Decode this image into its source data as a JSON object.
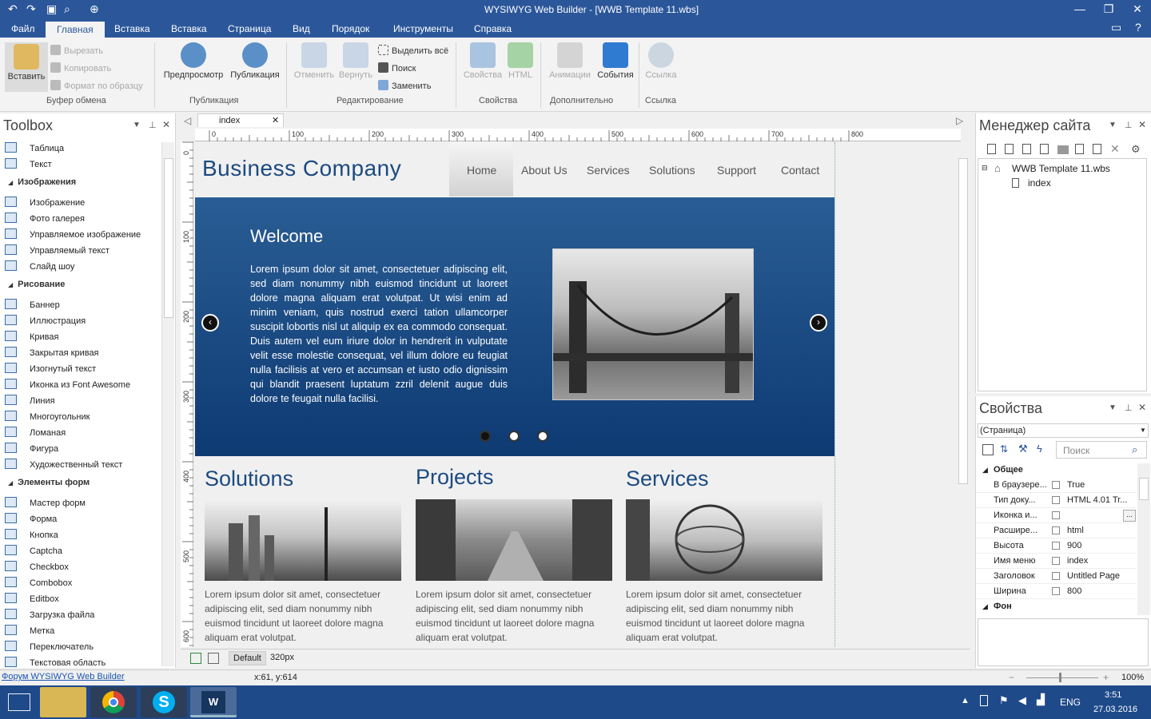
{
  "app": {
    "title": "WYSIWYG Web Builder - [WWB Template 11.wbs]"
  },
  "menu": {
    "items": [
      "Файл",
      "Главная",
      "Вставка",
      "Вставка",
      "Страница",
      "Вид",
      "Порядок",
      "Инструменты",
      "Справка"
    ],
    "active": "Главная"
  },
  "ribbon": {
    "paste": "Вставить",
    "cut": "Вырезать",
    "copy": "Копировать",
    "format": "Формат по образцу",
    "group_clipboard": "Буфер обмена",
    "preview": "Предпросмотр",
    "publish": "Публикация",
    "group_publish": "Публикация",
    "undo": "Отменить",
    "redo": "Вернуть",
    "select_all": "Выделить всё",
    "search": "Поиск",
    "replace": "Заменить",
    "group_edit": "Редактирование",
    "properties": "Свойства",
    "html": "HTML",
    "group_props": "Свойства",
    "animations": "Анимации",
    "events": "События",
    "group_extra": "Дополнительно",
    "link": "Ссылка",
    "group_link": "Ссылка"
  },
  "toolbox": {
    "title": "Toolbox",
    "items": [
      {
        "kind": "item",
        "label": "Таблица",
        "icon": "table-icon"
      },
      {
        "kind": "item",
        "label": "Текст",
        "icon": "text-icon"
      },
      {
        "kind": "cat",
        "label": "Изображения"
      },
      {
        "kind": "item",
        "label": "Изображение",
        "icon": "image-icon"
      },
      {
        "kind": "item",
        "label": "Фото галерея",
        "icon": "gallery-icon"
      },
      {
        "kind": "item",
        "label": "Управляемое изображение",
        "icon": "managed-image-icon"
      },
      {
        "kind": "item",
        "label": "Управляемый текст",
        "icon": "managed-text-icon"
      },
      {
        "kind": "item",
        "label": "Слайд шоу",
        "icon": "slideshow-icon"
      },
      {
        "kind": "cat",
        "label": "Рисование"
      },
      {
        "kind": "item",
        "label": "Баннер",
        "icon": "banner-icon"
      },
      {
        "kind": "item",
        "label": "Иллюстрация",
        "icon": "illustration-icon"
      },
      {
        "kind": "item",
        "label": "Кривая",
        "icon": "curve-icon"
      },
      {
        "kind": "item",
        "label": "Закрытая кривая",
        "icon": "closed-curve-icon"
      },
      {
        "kind": "item",
        "label": "Изогнутый текст",
        "icon": "curved-text-icon"
      },
      {
        "kind": "item",
        "label": "Иконка из Font Awesome",
        "icon": "font-awesome-icon"
      },
      {
        "kind": "item",
        "label": "Линия",
        "icon": "line-icon"
      },
      {
        "kind": "item",
        "label": "Многоугольник",
        "icon": "polygon-icon"
      },
      {
        "kind": "item",
        "label": "Ломаная",
        "icon": "polyline-icon"
      },
      {
        "kind": "item",
        "label": "Фигура",
        "icon": "shape-icon"
      },
      {
        "kind": "item",
        "label": "Художественный текст",
        "icon": "art-text-icon"
      },
      {
        "kind": "cat",
        "label": "Элементы форм"
      },
      {
        "kind": "item",
        "label": "Мастер форм",
        "icon": "form-wizard-icon"
      },
      {
        "kind": "item",
        "label": "Форма",
        "icon": "form-icon"
      },
      {
        "kind": "item",
        "label": "Кнопка",
        "icon": "button-icon"
      },
      {
        "kind": "item",
        "label": "Captcha",
        "icon": "captcha-icon"
      },
      {
        "kind": "item",
        "label": "Checkbox",
        "icon": "checkbox-icon"
      },
      {
        "kind": "item",
        "label": "Combobox",
        "icon": "combobox-icon"
      },
      {
        "kind": "item",
        "label": "Editbox",
        "icon": "editbox-icon"
      },
      {
        "kind": "item",
        "label": "Загрузка файла",
        "icon": "file-upload-icon"
      },
      {
        "kind": "item",
        "label": "Метка",
        "icon": "label-icon"
      },
      {
        "kind": "item",
        "label": "Переключатель",
        "icon": "radio-icon"
      },
      {
        "kind": "item",
        "label": "Текстовая область",
        "icon": "textarea-icon"
      }
    ]
  },
  "doc": {
    "tab": "index",
    "ruler": [
      "0",
      "100",
      "200",
      "300",
      "400",
      "500",
      "600",
      "700",
      "800"
    ],
    "vruler": [
      "0",
      "100",
      "200",
      "300",
      "400",
      "500",
      "600"
    ]
  },
  "site": {
    "brand": "Business Company",
    "nav": [
      "Home",
      "About Us",
      "Services",
      "Solutions",
      "Support",
      "Contact"
    ],
    "hero_title": "Welcome",
    "hero_text": "Lorem ipsum dolor sit amet, consectetuer adipiscing elit, sed diam nonummy nibh euismod tincidunt ut laoreet dolore magna aliquam erat volutpat. Ut wisi enim ad minim veniam, quis nostrud exerci tation ullamcorper suscipit lobortis nisl ut aliquip ex ea commodo consequat. Duis autem vel eum iriure dolor in hendrerit in vulputate velit esse molestie consequat, vel illum dolore eu feugiat nulla facilisis at vero et accumsan et iusto odio dignissim qui blandit praesent luptatum zzril delenit augue duis dolore te feugait nulla facilisi.",
    "columns": [
      {
        "title": "Solutions",
        "text": "Lorem ipsum dolor sit amet, consectetuer adipiscing elit, sed diam nonummy nibh euismod tincidunt ut laoreet dolore magna aliquam erat volutpat."
      },
      {
        "title": "Projects",
        "text": "Lorem ipsum dolor sit amet, consectetuer adipiscing elit, sed diam nonummy nibh euismod tincidunt ut laoreet dolore magna aliquam erat volutpat."
      },
      {
        "title": "Services",
        "text": "Lorem ipsum dolor sit amet, consectetuer adipiscing elit, sed diam nonummy nibh euismod tincidunt ut laoreet dolore magna aliquam erat volutpat."
      }
    ]
  },
  "breakpoints": {
    "default": "Default",
    "size": "320px"
  },
  "sitemgr": {
    "title": "Менеджер сайта",
    "root": "WWB Template 11.wbs",
    "page": "index"
  },
  "props": {
    "title": "Свойства",
    "selector": "(Страница)",
    "search_placeholder": "Поиск",
    "cat_general": "Общее",
    "cat_bg": "Фон",
    "rows": [
      {
        "k": "В браузере...",
        "v": "True"
      },
      {
        "k": "Тип доку...",
        "v": "HTML 4.01 Tr..."
      },
      {
        "k": "Иконка и...",
        "v": ""
      },
      {
        "k": "Расшире...",
        "v": "html"
      },
      {
        "k": "Высота",
        "v": "900"
      },
      {
        "k": "Имя меню",
        "v": "index"
      },
      {
        "k": "Заголовок",
        "v": "Untitled Page"
      },
      {
        "k": "Ширина",
        "v": "800"
      }
    ]
  },
  "status": {
    "forum": "Форум WYSIWYG Web Builder",
    "coords": "x:61, y:614",
    "zoom": "100%"
  },
  "taskbar": {
    "lang": "ENG",
    "time": "3:51",
    "date": "27.03.2016"
  }
}
